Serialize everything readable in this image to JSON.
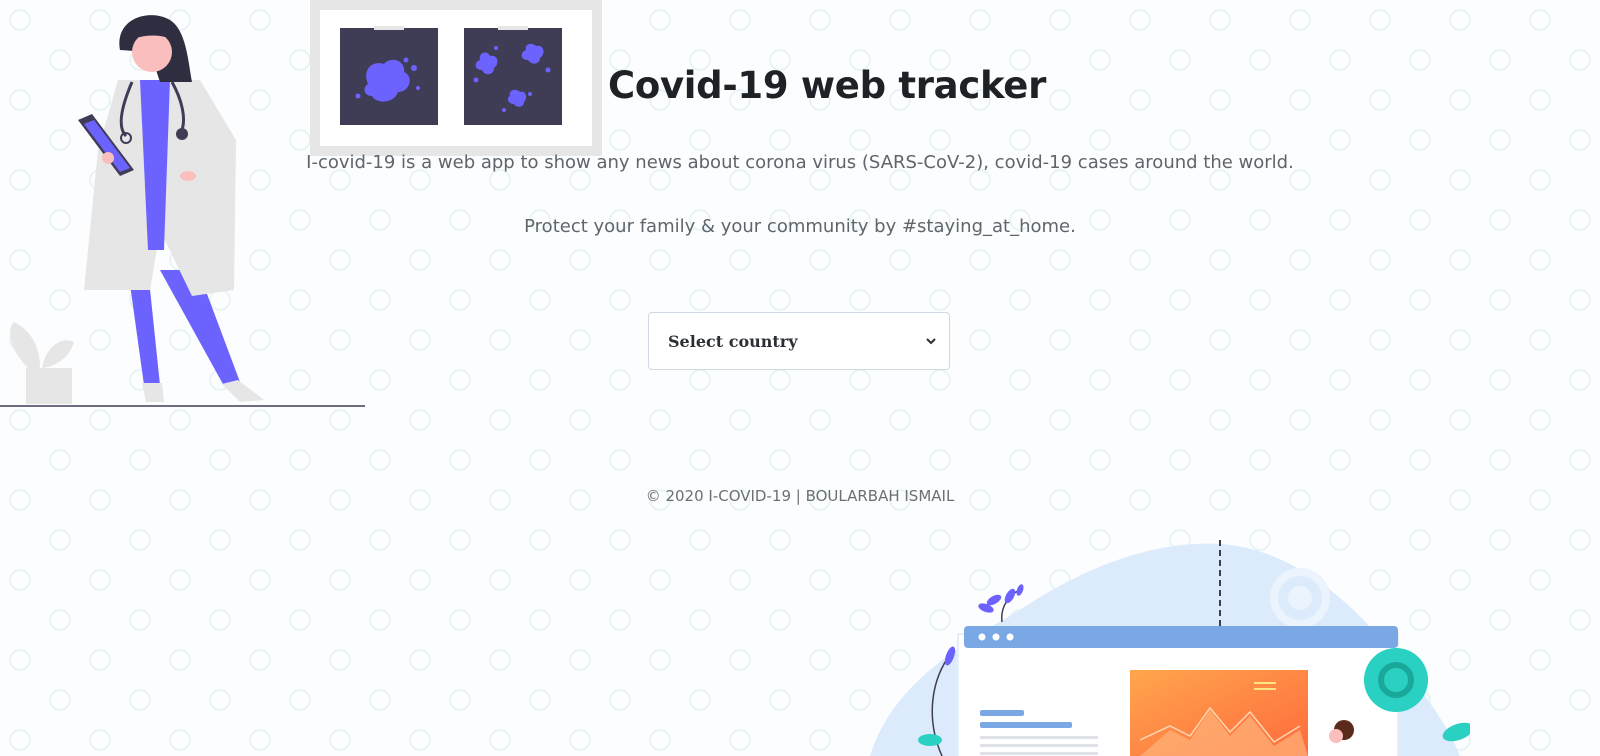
{
  "header": {
    "title": "Covid-19 web tracker",
    "description": "I-covid-19 is a web app to show any news about corona virus (SARS-CoV-2), covid-19 cases around the world.",
    "tagline": "Protect your family & your community by #staying_at_home."
  },
  "country_select": {
    "selected": "Select country",
    "icon": "chevron-down-icon"
  },
  "footer": {
    "copyright": "© 2020 I-COVID-19 | BOULARBAH ISMAIL"
  },
  "colors": {
    "accent": "#6c63ff",
    "dark": "#3f3d56",
    "teal": "#2ad1c2",
    "orange": "#ff8a3d"
  }
}
